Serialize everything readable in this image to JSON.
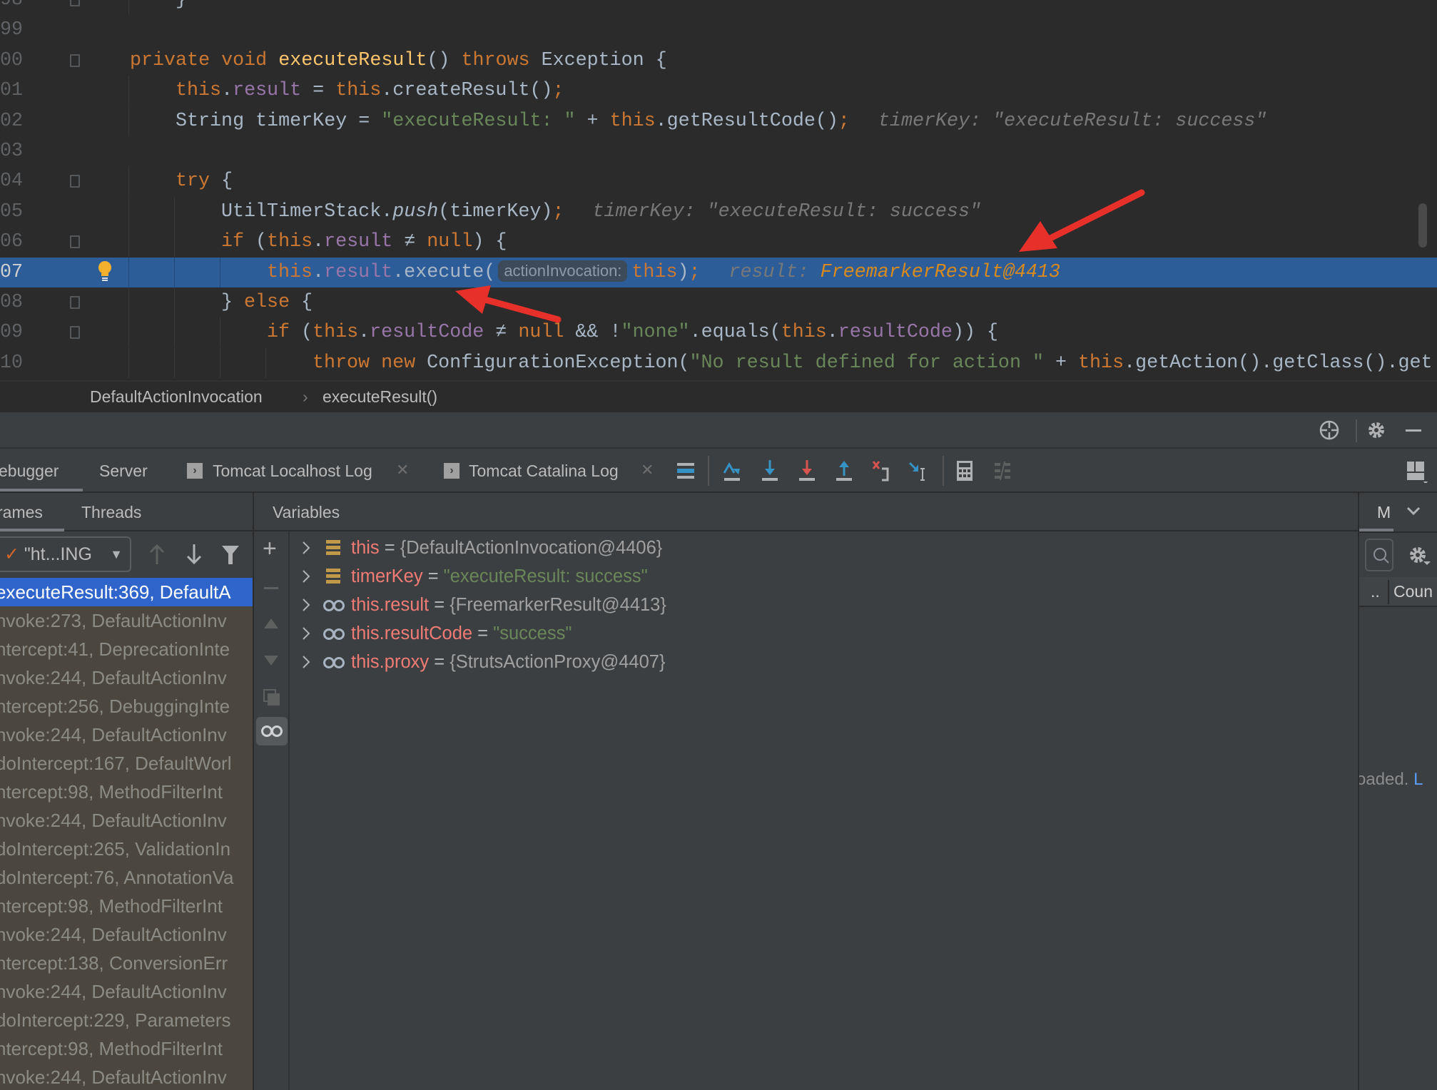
{
  "editor": {
    "lines": [
      {
        "num": "98",
        "indent": 1,
        "fold": true,
        "tokens": [
          [
            "}",
            "txt"
          ]
        ]
      },
      {
        "num": "99",
        "indent": 0,
        "tokens": []
      },
      {
        "num": "00",
        "indent": 0,
        "fold": true,
        "tokens": [
          [
            "private ",
            "kw"
          ],
          [
            "void ",
            "kw"
          ],
          [
            "executeResult",
            "def"
          ],
          [
            "() ",
            "txt"
          ],
          [
            "throws ",
            "kw"
          ],
          [
            "Exception {",
            "txt"
          ]
        ]
      },
      {
        "num": "01",
        "indent": 1,
        "tokens": [
          [
            "this",
            "kw"
          ],
          [
            ".",
            "txt"
          ],
          [
            "result",
            "fld"
          ],
          [
            " = ",
            "txt"
          ],
          [
            "this",
            "kw"
          ],
          [
            ".createResult()",
            "txt"
          ],
          [
            ";",
            "kw"
          ]
        ]
      },
      {
        "num": "02",
        "indent": 1,
        "tokens": [
          [
            "String timerKey = ",
            "txt"
          ],
          [
            "\"executeResult: \"",
            "str"
          ],
          [
            " + ",
            "txt"
          ],
          [
            "this",
            "kw"
          ],
          [
            ".getResultCode()",
            "txt"
          ],
          [
            ";",
            "kw"
          ]
        ],
        "hint": "timerKey: \"executeResult: success\""
      },
      {
        "num": "03",
        "indent": 0,
        "tokens": []
      },
      {
        "num": "04",
        "indent": 1,
        "fold": true,
        "tokens": [
          [
            "try ",
            "kw"
          ],
          [
            "{",
            "txt"
          ]
        ]
      },
      {
        "num": "05",
        "indent": 2,
        "tokens": [
          [
            "UtilTimerStack.",
            "txt"
          ],
          [
            "push",
            "it"
          ],
          [
            "(timerKey)",
            "txt"
          ],
          [
            ";",
            "kw"
          ]
        ],
        "hint": "timerKey: \"executeResult: success\""
      },
      {
        "num": "06",
        "indent": 2,
        "fold": true,
        "tokens": [
          [
            "if ",
            "kw"
          ],
          [
            "(",
            "txt"
          ],
          [
            "this",
            "kw"
          ],
          [
            ".",
            "txt"
          ],
          [
            "result",
            "fld"
          ],
          [
            " ≠ ",
            "txt"
          ],
          [
            "null",
            "kw"
          ],
          [
            ") {",
            "txt"
          ]
        ]
      },
      {
        "num": "07",
        "indent": 3,
        "current": true,
        "tokens": [
          [
            "this",
            "kw"
          ],
          [
            ".",
            "txt"
          ],
          [
            "result",
            "fld"
          ],
          [
            ".execute(",
            "txt"
          ]
        ],
        "inlay": "actionInvocation:",
        "tokens_after": [
          [
            "this",
            "kw"
          ],
          [
            ")",
            "txt"
          ],
          [
            ";",
            "kw"
          ]
        ],
        "hint": "result:",
        "hint_value": "FreemarkerResult@4413"
      },
      {
        "num": "08",
        "indent": 2,
        "fold": true,
        "tokens": [
          [
            "} ",
            "txt"
          ],
          [
            "else ",
            "kw"
          ],
          [
            "{",
            "txt"
          ]
        ]
      },
      {
        "num": "09",
        "indent": 3,
        "fold": true,
        "tokens": [
          [
            "if ",
            "kw"
          ],
          [
            "(",
            "txt"
          ],
          [
            "this",
            "kw"
          ],
          [
            ".",
            "txt"
          ],
          [
            "resultCode",
            "fld"
          ],
          [
            " ≠ ",
            "txt"
          ],
          [
            "null",
            "kw"
          ],
          [
            " && !",
            "txt"
          ],
          [
            "\"none\"",
            "str"
          ],
          [
            ".equals(",
            "txt"
          ],
          [
            "this",
            "kw"
          ],
          [
            ".",
            "txt"
          ],
          [
            "resultCode",
            "fld"
          ],
          [
            ")) {",
            "txt"
          ]
        ]
      },
      {
        "num": "10",
        "indent": 4,
        "tokens": [
          [
            "throw ",
            "kw"
          ],
          [
            "new ",
            "kw"
          ],
          [
            "ConfigurationException(",
            "txt"
          ],
          [
            "\"No result defined for action \"",
            "str"
          ],
          [
            " + ",
            "txt"
          ],
          [
            "this",
            "kw"
          ],
          [
            ".getAction().getClass().get",
            "txt"
          ]
        ]
      }
    ]
  },
  "breadcrumb": {
    "items": [
      "DefaultActionInvocation",
      "executeResult()"
    ],
    "separator": "›"
  },
  "debug_tabs": [
    {
      "label": "ebugger"
    },
    {
      "label": "Server"
    },
    {
      "label": "Tomcat Localhost Log",
      "closable": true
    },
    {
      "label": "Tomcat Catalina Log",
      "closable": true
    }
  ],
  "toolbar_icons": [
    "show-execution-point-icon",
    "step-over-icon",
    "step-into-icon",
    "force-step-into-icon",
    "step-out-icon",
    "drop-frame-icon",
    "run-to-cursor-icon",
    "evaluate-expression-icon",
    "trace-current-stream-icon",
    "layout-icon"
  ],
  "header_icons": [
    "target-icon",
    "gear-icon",
    "minimize-icon"
  ],
  "subtabs": {
    "frames": "rames",
    "threads": "Threads",
    "variables": "Variables",
    "memory": "M"
  },
  "thread_dropdown": {
    "value": "\"ht...ING"
  },
  "frames": [
    "executeResult:369, DefaultA",
    "nvoke:273, DefaultActionInv",
    "ntercept:41, DeprecationInte",
    "nvoke:244, DefaultActionInv",
    "ntercept:256, DebuggingInte",
    "nvoke:244, DefaultActionInv",
    "doIntercept:167, DefaultWorl",
    "ntercept:98, MethodFilterInt",
    "nvoke:244, DefaultActionInv",
    "doIntercept:265, ValidationIn",
    "doIntercept:76, AnnotationVa",
    "ntercept:98, MethodFilterInt",
    "nvoke:244, DefaultActionInv",
    "ntercept:138, ConversionErr",
    "nvoke:244, DefaultActionInv",
    "doIntercept:229, Parameters",
    "ntercept:98, MethodFilterInt",
    "nvoke:244, DefaultActionInv"
  ],
  "variables": [
    {
      "name": "this",
      "eq": " = ",
      "value": "{DefaultActionInvocation@4406}",
      "kind": "obj",
      "icon": "field-icon"
    },
    {
      "name": "timerKey",
      "eq": " = ",
      "value": "\"executeResult: success\"",
      "kind": "str",
      "icon": "field-icon"
    },
    {
      "name": "this.result",
      "eq": " = ",
      "value": "{FreemarkerResult@4413}",
      "kind": "obj",
      "icon": "watch-icon"
    },
    {
      "name": "this.resultCode",
      "eq": " = ",
      "value": "\"success\"",
      "kind": "str",
      "icon": "watch-icon"
    },
    {
      "name": "this.proxy",
      "eq": " = ",
      "value": "{StrutsActionProxy@4407}",
      "kind": "obj",
      "icon": "watch-icon"
    }
  ],
  "memory_panel": {
    "col1": "..",
    "col2": "Coun",
    "status": "oaded.",
    "link": "L"
  },
  "colors": {
    "highlight": "#2d5d98",
    "selected_frame": "#2f65ca",
    "arrow": "#e8302a",
    "keyword": "#cc7832",
    "field": "#9876aa",
    "string": "#6a8759"
  }
}
